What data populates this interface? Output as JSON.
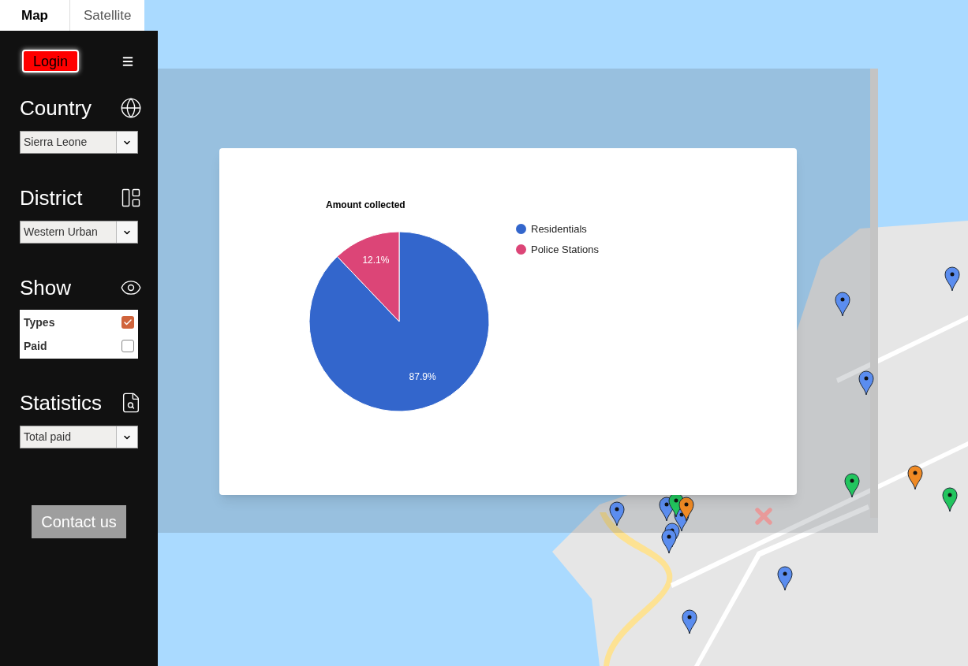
{
  "tabs": [
    {
      "label": "Map",
      "selected": true
    },
    {
      "label": "Satellite",
      "selected": false
    }
  ],
  "sidebar": {
    "login_button": "Login",
    "sections": [
      {
        "kind": "select",
        "title": "Country",
        "value": "Sierra Leone"
      },
      {
        "kind": "select",
        "title": "District",
        "value": "Western Urban"
      },
      {
        "kind": "checklist",
        "title": "Show",
        "options": [
          {
            "label": "Types",
            "checked": true
          },
          {
            "label": "Paid",
            "checked": false
          }
        ]
      },
      {
        "kind": "select",
        "title": "Statistics",
        "value": "Total paid"
      }
    ],
    "contact_button": "Contact us"
  },
  "map": {
    "markers": [
      {
        "color": "#5b8def"
      },
      {
        "color": "#5b8def"
      },
      {
        "color": "#5b8def"
      },
      {
        "color": "#5b8def"
      },
      {
        "color": "#5b8def"
      },
      {
        "color": "#5b8def"
      },
      {
        "color": "#5b8def"
      },
      {
        "color": "#5b8def"
      },
      {
        "color": "#5b8def"
      },
      {
        "color": "#5b8def"
      },
      {
        "color": "#22c55e"
      },
      {
        "color": "#22c55e"
      },
      {
        "color": "#22c55e"
      },
      {
        "color": "#f08a24"
      },
      {
        "color": "#f08a24"
      }
    ]
  },
  "dialog": {
    "chart_data": {
      "type": "pie",
      "title": "Amount collected",
      "categories": [
        "Residentials",
        "Police Stations"
      ],
      "series": [
        {
          "values": [
            87.9,
            12.1
          ],
          "colors": [
            "#3366cc",
            "#dc4577"
          ]
        }
      ],
      "legend": "right",
      "data_labels": "value_labels",
      "value_labels": [
        "87.9%",
        "12.1%"
      ]
    }
  }
}
